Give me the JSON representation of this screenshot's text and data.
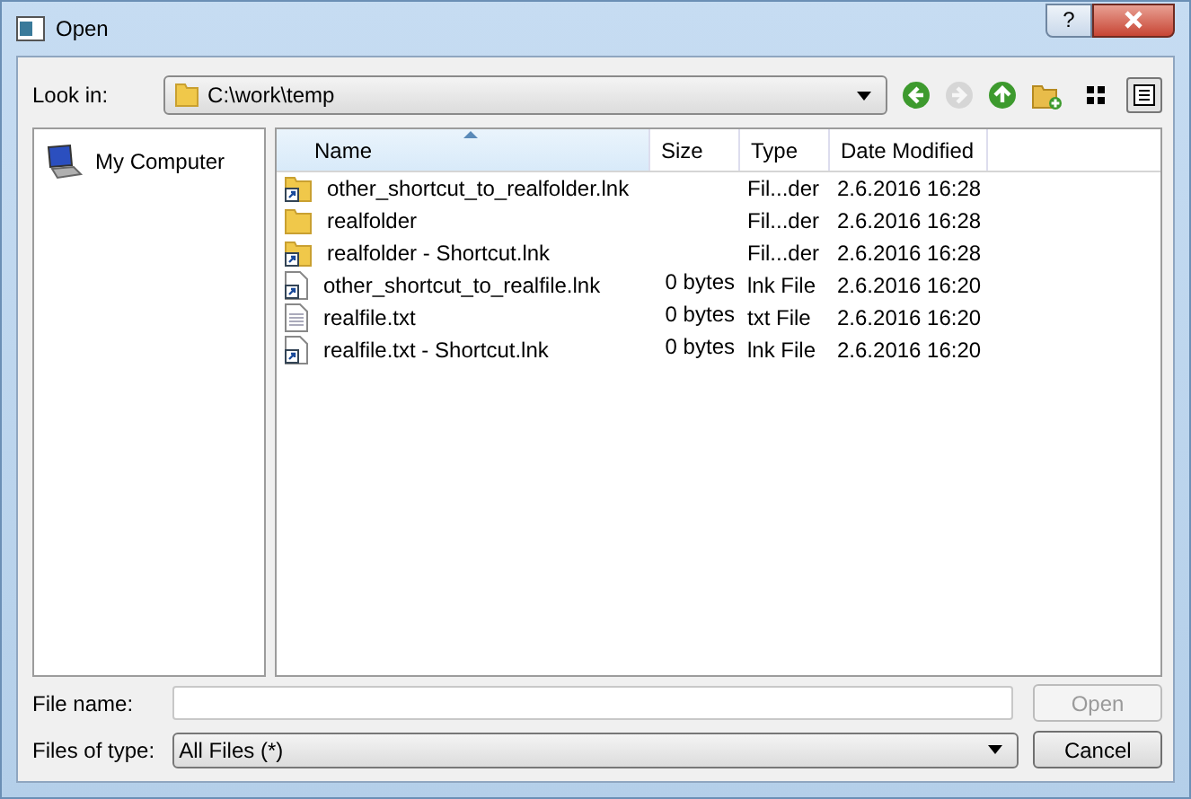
{
  "window": {
    "title": "Open",
    "help_button": "?"
  },
  "look_in": {
    "label": "Look in:",
    "value": "C:\\work\\temp"
  },
  "toolbar": [
    {
      "kind": "back",
      "disabled": false
    },
    {
      "kind": "forward",
      "disabled": true
    },
    {
      "kind": "up",
      "disabled": false
    },
    {
      "kind": "new-folder",
      "disabled": false
    },
    {
      "kind": "list-view",
      "selected": false
    },
    {
      "kind": "detail-view",
      "selected": true
    }
  ],
  "sidebar": {
    "items": [
      {
        "label": "My Computer",
        "selected": false
      }
    ]
  },
  "table": {
    "columns": [
      {
        "label": "Name",
        "sorted": true
      },
      {
        "label": "Size",
        "sorted": false
      },
      {
        "label": "Type",
        "sorted": false
      },
      {
        "label": "Date Modified",
        "sorted": false
      }
    ],
    "rows": [
      {
        "kind": "folder-shortcut",
        "name": "other_shortcut_to_realfolder.lnk",
        "type": "Fil...der",
        "date": "2.6.2016 16:28"
      },
      {
        "kind": "folder",
        "name": "realfolder",
        "type": "Fil...der",
        "date": "2.6.2016 16:28"
      },
      {
        "kind": "folder-shortcut",
        "name": "realfolder - Shortcut.lnk",
        "type": "Fil...der",
        "date": "2.6.2016 16:28"
      },
      {
        "kind": "file-shortcut",
        "name": "other_shortcut_to_realfile.lnk",
        "size": "0 bytes",
        "type": "lnk File",
        "date": "2.6.2016 16:20"
      },
      {
        "kind": "text",
        "name": "realfile.txt",
        "size": "0 bytes",
        "type": "txt File",
        "date": "2.6.2016 16:20"
      },
      {
        "kind": "file-shortcut",
        "name": "realfile.txt - Shortcut.lnk",
        "size": "0 bytes",
        "type": "lnk File",
        "date": "2.6.2016 16:20"
      }
    ]
  },
  "file_name": {
    "label": "File name:"
  },
  "file_type": {
    "label": "Files of type:",
    "value": "All Files (*)"
  },
  "buttons": [
    {
      "label": "Open",
      "disabled": true
    },
    {
      "label": "Cancel",
      "disabled": false
    }
  ]
}
